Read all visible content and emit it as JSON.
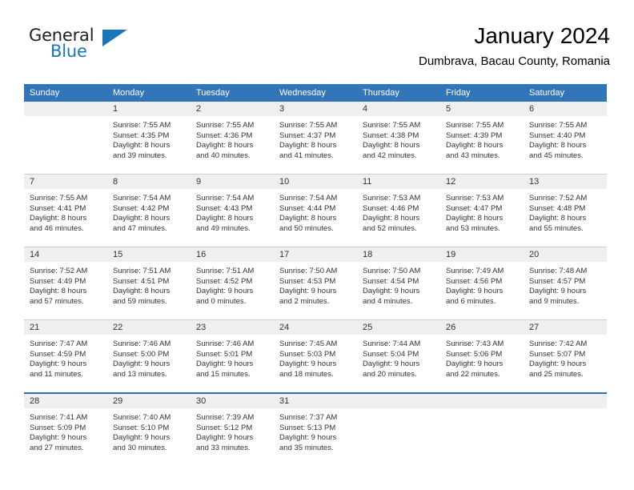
{
  "brand": {
    "name_part1": "General",
    "name_part2": "Blue"
  },
  "header": {
    "title": "January 2024",
    "subtitle": "Dumbrava, Bacau County, Romania"
  },
  "colors": {
    "header_blue": "#3275b8",
    "brand_blue": "#1b75bb",
    "daynum_band": "#efefef",
    "text": "#333333"
  },
  "weekday_headers": [
    "Sunday",
    "Monday",
    "Tuesday",
    "Wednesday",
    "Thursday",
    "Friday",
    "Saturday"
  ],
  "labels": {
    "sunrise_prefix": "Sunrise:",
    "sunset_prefix": "Sunset:",
    "daylight_prefix": "Daylight:"
  },
  "weeks": [
    [
      {
        "day": "",
        "line1": "",
        "line2": "",
        "line3": "",
        "line4": ""
      },
      {
        "day": "1",
        "line1": "Sunrise: 7:55 AM",
        "line2": "Sunset: 4:35 PM",
        "line3": "Daylight: 8 hours",
        "line4": "and 39 minutes."
      },
      {
        "day": "2",
        "line1": "Sunrise: 7:55 AM",
        "line2": "Sunset: 4:36 PM",
        "line3": "Daylight: 8 hours",
        "line4": "and 40 minutes."
      },
      {
        "day": "3",
        "line1": "Sunrise: 7:55 AM",
        "line2": "Sunset: 4:37 PM",
        "line3": "Daylight: 8 hours",
        "line4": "and 41 minutes."
      },
      {
        "day": "4",
        "line1": "Sunrise: 7:55 AM",
        "line2": "Sunset: 4:38 PM",
        "line3": "Daylight: 8 hours",
        "line4": "and 42 minutes."
      },
      {
        "day": "5",
        "line1": "Sunrise: 7:55 AM",
        "line2": "Sunset: 4:39 PM",
        "line3": "Daylight: 8 hours",
        "line4": "and 43 minutes."
      },
      {
        "day": "6",
        "line1": "Sunrise: 7:55 AM",
        "line2": "Sunset: 4:40 PM",
        "line3": "Daylight: 8 hours",
        "line4": "and 45 minutes."
      }
    ],
    [
      {
        "day": "7",
        "line1": "Sunrise: 7:55 AM",
        "line2": "Sunset: 4:41 PM",
        "line3": "Daylight: 8 hours",
        "line4": "and 46 minutes."
      },
      {
        "day": "8",
        "line1": "Sunrise: 7:54 AM",
        "line2": "Sunset: 4:42 PM",
        "line3": "Daylight: 8 hours",
        "line4": "and 47 minutes."
      },
      {
        "day": "9",
        "line1": "Sunrise: 7:54 AM",
        "line2": "Sunset: 4:43 PM",
        "line3": "Daylight: 8 hours",
        "line4": "and 49 minutes."
      },
      {
        "day": "10",
        "line1": "Sunrise: 7:54 AM",
        "line2": "Sunset: 4:44 PM",
        "line3": "Daylight: 8 hours",
        "line4": "and 50 minutes."
      },
      {
        "day": "11",
        "line1": "Sunrise: 7:53 AM",
        "line2": "Sunset: 4:46 PM",
        "line3": "Daylight: 8 hours",
        "line4": "and 52 minutes."
      },
      {
        "day": "12",
        "line1": "Sunrise: 7:53 AM",
        "line2": "Sunset: 4:47 PM",
        "line3": "Daylight: 8 hours",
        "line4": "and 53 minutes."
      },
      {
        "day": "13",
        "line1": "Sunrise: 7:52 AM",
        "line2": "Sunset: 4:48 PM",
        "line3": "Daylight: 8 hours",
        "line4": "and 55 minutes."
      }
    ],
    [
      {
        "day": "14",
        "line1": "Sunrise: 7:52 AM",
        "line2": "Sunset: 4:49 PM",
        "line3": "Daylight: 8 hours",
        "line4": "and 57 minutes."
      },
      {
        "day": "15",
        "line1": "Sunrise: 7:51 AM",
        "line2": "Sunset: 4:51 PM",
        "line3": "Daylight: 8 hours",
        "line4": "and 59 minutes."
      },
      {
        "day": "16",
        "line1": "Sunrise: 7:51 AM",
        "line2": "Sunset: 4:52 PM",
        "line3": "Daylight: 9 hours",
        "line4": "and 0 minutes."
      },
      {
        "day": "17",
        "line1": "Sunrise: 7:50 AM",
        "line2": "Sunset: 4:53 PM",
        "line3": "Daylight: 9 hours",
        "line4": "and 2 minutes."
      },
      {
        "day": "18",
        "line1": "Sunrise: 7:50 AM",
        "line2": "Sunset: 4:54 PM",
        "line3": "Daylight: 9 hours",
        "line4": "and 4 minutes."
      },
      {
        "day": "19",
        "line1": "Sunrise: 7:49 AM",
        "line2": "Sunset: 4:56 PM",
        "line3": "Daylight: 9 hours",
        "line4": "and 6 minutes."
      },
      {
        "day": "20",
        "line1": "Sunrise: 7:48 AM",
        "line2": "Sunset: 4:57 PM",
        "line3": "Daylight: 9 hours",
        "line4": "and 9 minutes."
      }
    ],
    [
      {
        "day": "21",
        "line1": "Sunrise: 7:47 AM",
        "line2": "Sunset: 4:59 PM",
        "line3": "Daylight: 9 hours",
        "line4": "and 11 minutes."
      },
      {
        "day": "22",
        "line1": "Sunrise: 7:46 AM",
        "line2": "Sunset: 5:00 PM",
        "line3": "Daylight: 9 hours",
        "line4": "and 13 minutes."
      },
      {
        "day": "23",
        "line1": "Sunrise: 7:46 AM",
        "line2": "Sunset: 5:01 PM",
        "line3": "Daylight: 9 hours",
        "line4": "and 15 minutes."
      },
      {
        "day": "24",
        "line1": "Sunrise: 7:45 AM",
        "line2": "Sunset: 5:03 PM",
        "line3": "Daylight: 9 hours",
        "line4": "and 18 minutes."
      },
      {
        "day": "25",
        "line1": "Sunrise: 7:44 AM",
        "line2": "Sunset: 5:04 PM",
        "line3": "Daylight: 9 hours",
        "line4": "and 20 minutes."
      },
      {
        "day": "26",
        "line1": "Sunrise: 7:43 AM",
        "line2": "Sunset: 5:06 PM",
        "line3": "Daylight: 9 hours",
        "line4": "and 22 minutes."
      },
      {
        "day": "27",
        "line1": "Sunrise: 7:42 AM",
        "line2": "Sunset: 5:07 PM",
        "line3": "Daylight: 9 hours",
        "line4": "and 25 minutes."
      }
    ],
    [
      {
        "day": "28",
        "line1": "Sunrise: 7:41 AM",
        "line2": "Sunset: 5:09 PM",
        "line3": "Daylight: 9 hours",
        "line4": "and 27 minutes."
      },
      {
        "day": "29",
        "line1": "Sunrise: 7:40 AM",
        "line2": "Sunset: 5:10 PM",
        "line3": "Daylight: 9 hours",
        "line4": "and 30 minutes."
      },
      {
        "day": "30",
        "line1": "Sunrise: 7:39 AM",
        "line2": "Sunset: 5:12 PM",
        "line3": "Daylight: 9 hours",
        "line4": "and 33 minutes."
      },
      {
        "day": "31",
        "line1": "Sunrise: 7:37 AM",
        "line2": "Sunset: 5:13 PM",
        "line3": "Daylight: 9 hours",
        "line4": "and 35 minutes."
      },
      {
        "day": "",
        "line1": "",
        "line2": "",
        "line3": "",
        "line4": ""
      },
      {
        "day": "",
        "line1": "",
        "line2": "",
        "line3": "",
        "line4": ""
      },
      {
        "day": "",
        "line1": "",
        "line2": "",
        "line3": "",
        "line4": ""
      }
    ]
  ]
}
